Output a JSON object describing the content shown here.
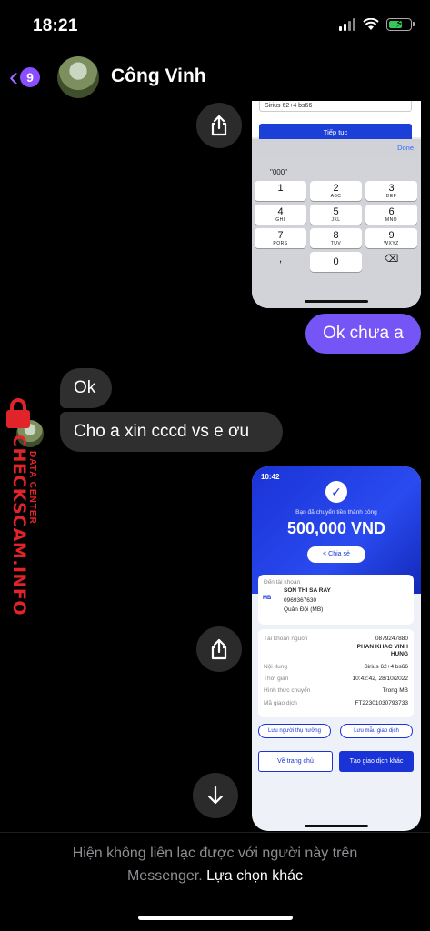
{
  "status_bar": {
    "time": "18:21"
  },
  "header": {
    "unread_count": "9",
    "contact_name": "Công Vinh"
  },
  "keypad_image": {
    "field_text": "Sirius 62+4 bs66",
    "continue_label": "Tiếp tục",
    "done_label": "Done",
    "suggestion": "\"000\"",
    "keys": [
      {
        "n": "1",
        "l": ""
      },
      {
        "n": "2",
        "l": "ABC"
      },
      {
        "n": "3",
        "l": "DEF"
      },
      {
        "n": "4",
        "l": "GHI"
      },
      {
        "n": "5",
        "l": "JKL"
      },
      {
        "n": "6",
        "l": "MNO"
      },
      {
        "n": "7",
        "l": "PQRS"
      },
      {
        "n": "8",
        "l": "TUV"
      },
      {
        "n": "9",
        "l": "WXYZ"
      },
      {
        "n": ",",
        "l": ""
      },
      {
        "n": "0",
        "l": ""
      },
      {
        "n": "⌫",
        "l": ""
      }
    ]
  },
  "messages": {
    "outgoing_1": "Ok chưa a",
    "incoming_1": "Ok",
    "incoming_2": "Cho a xin cccd vs e ơu"
  },
  "watermark": {
    "site": "CHECKSCAM.INFO",
    "center": "DATA CENTER"
  },
  "receipt_image": {
    "time": "10:42",
    "success_text": "Bạn đã chuyển tiền thành công",
    "amount": "500,000 VND",
    "share_label": "Chia sẻ",
    "to_label": "Đến tài khoản",
    "bank_logo": "MB",
    "recipient_name": "SON THI SA RAY",
    "recipient_account": "0969367630",
    "recipient_bank": "Quân Đội (MB)",
    "rows": [
      {
        "k": "Tài khoản nguồn",
        "v": "0879247880"
      },
      {
        "k": "",
        "v": "PHAN KHAC VINH"
      },
      {
        "k": "",
        "v": "HUNG"
      },
      {
        "k": "Nội dung",
        "v": "Sirius 62+4 bs66"
      },
      {
        "k": "Thời gian",
        "v": "10:42:42, 28/10/2022"
      },
      {
        "k": "Hình thức chuyển",
        "v": "Trong MB"
      },
      {
        "k": "Mã giao dịch",
        "v": "FT22301030793733"
      }
    ],
    "save_recipient": "Lưu người thụ hưởng",
    "save_template": "Lưu mẫu giao dịch",
    "home_button": "Về trang chủ",
    "new_transaction_button": "Tạo giao dịch khác"
  },
  "footer": {
    "message": "Hiện không liên lạc được với người này trên Messenger.",
    "link": "Lựa chọn khác"
  },
  "colors": {
    "accent": "#7655f6",
    "incoming_bubble": "#2f2f2f",
    "watermark": "#e0242a"
  }
}
